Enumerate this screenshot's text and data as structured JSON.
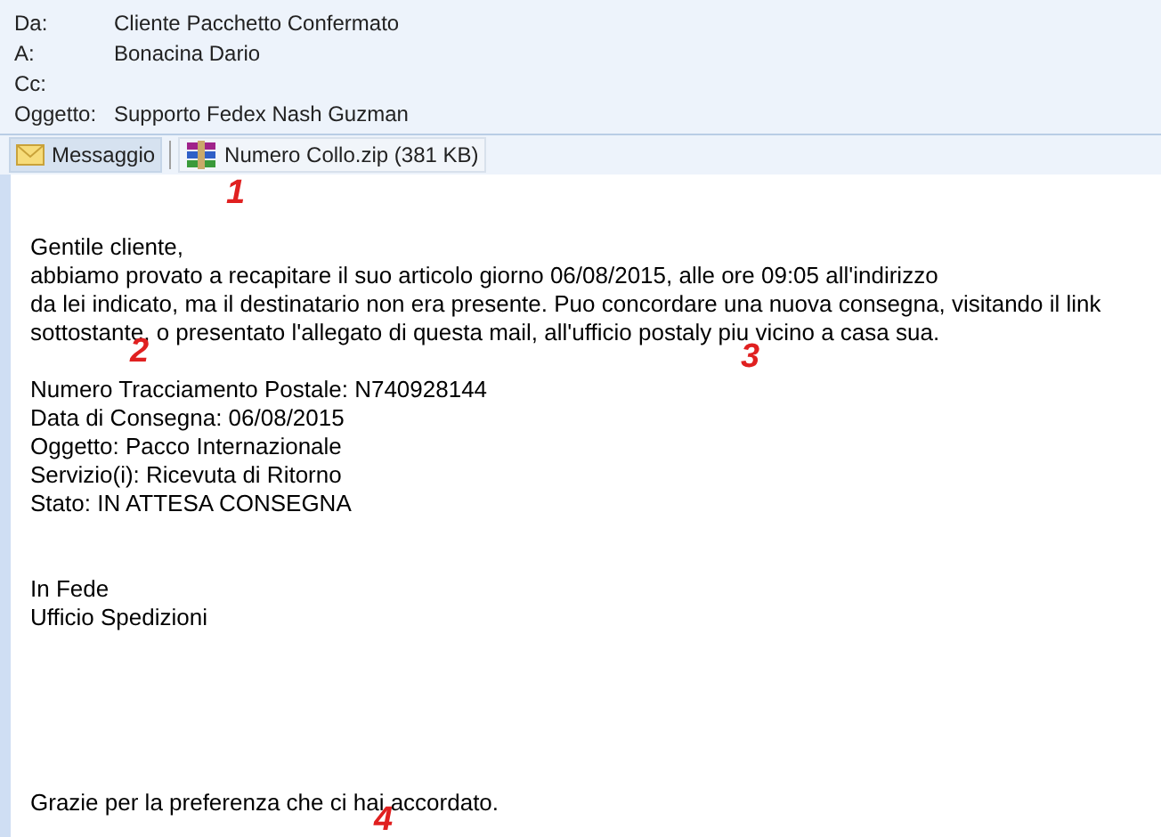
{
  "header": [
    {
      "label": "Da:",
      "value": "Cliente Pacchetto Confermato"
    },
    {
      "label": "A:",
      "value": "Bonacina Dario"
    },
    {
      "label": "Cc:"
    },
    {
      "label": "Oggetto:",
      "value": "Supporto Fedex Nash Guzman"
    }
  ],
  "attachments": [
    {
      "kind": "message",
      "label": "Messaggio",
      "selected": true
    },
    {
      "kind": "zip",
      "label": "Numero Collo.zip (381 KB)",
      "selected": false
    }
  ],
  "body": {
    "paragraphs": [
      [
        "Gentile cliente,",
        "abbiamo provato a recapitare il suo articolo giorno 06/08/2015, alle ore 09:05 all'indirizzo",
        "da lei indicato, ma il destinatario non era presente. Puo concordare una nuova consegna, visitando il link",
        "sottostante, o presentato l'allegato di questa mail, all'ufficio postaly piu vicino a casa sua."
      ],
      [
        "Numero Tracciamento Postale: N740928144",
        "Data di Consegna: 06/08/2015",
        "Oggetto: Pacco Internazionale",
        "Servizio(i): Ricevuta di Ritorno",
        "Stato: IN ATTESA CONSEGNA"
      ],
      [
        "In Fede",
        "Ufficio Spedizioni"
      ],
      [
        "Grazie per la preferenza che ci hai accordato."
      ]
    ]
  },
  "annotations": [
    "1",
    "2",
    "3",
    "4"
  ]
}
